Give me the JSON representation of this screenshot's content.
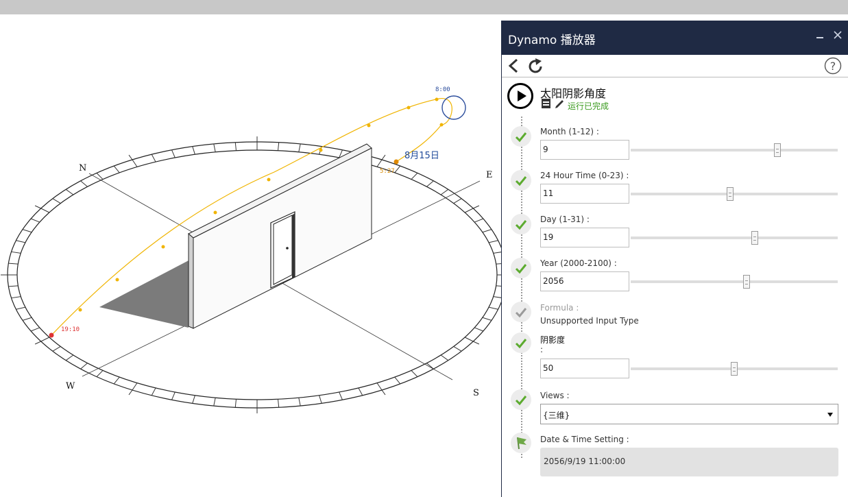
{
  "viewport": {
    "compass": {
      "north": "N",
      "east": "E",
      "south": "S",
      "west": "W"
    },
    "sun_path": {
      "date_label": "8月15日",
      "sunrise_time": "5:27",
      "sunset_time": "19:10",
      "current_time": "8:00",
      "path_color": "#f0b400"
    }
  },
  "panel": {
    "title": "Dynamo 播放器",
    "header_colour": "#1f2a44",
    "window_controls": {
      "minimize_icon": "minimize-icon",
      "close_icon": "close-icon"
    },
    "toolbar": {
      "back_icon": "back-icon",
      "refresh_icon": "refresh-icon",
      "help_icon": "help-icon"
    },
    "script": {
      "name": "太阳阴影角度",
      "status": "运行已完成",
      "status_colour": "#3a9a1e"
    },
    "inputs": [
      {
        "label": "Month (1-12) :",
        "value": "9",
        "slider_fraction": 0.71
      },
      {
        "label": "24 Hour Time (0-23) :",
        "value": "11",
        "slider_fraction": 0.48
      },
      {
        "label": "Day (1-31) :",
        "value": "19",
        "slider_fraction": 0.6
      },
      {
        "label": "Year (2000-2100) :",
        "value": "2056",
        "slider_fraction": 0.56
      }
    ],
    "formula": {
      "label": "Formula :",
      "value": "Unsupported Input Type"
    },
    "shadow": {
      "label": "阴影度",
      "colon": ":",
      "value": "50",
      "slider_fraction": 0.5
    },
    "views": {
      "label": "Views :",
      "selected": "{三维}"
    },
    "output": {
      "label": "Date & Time Setting :",
      "value": "2056/9/19 11:00:00"
    }
  }
}
